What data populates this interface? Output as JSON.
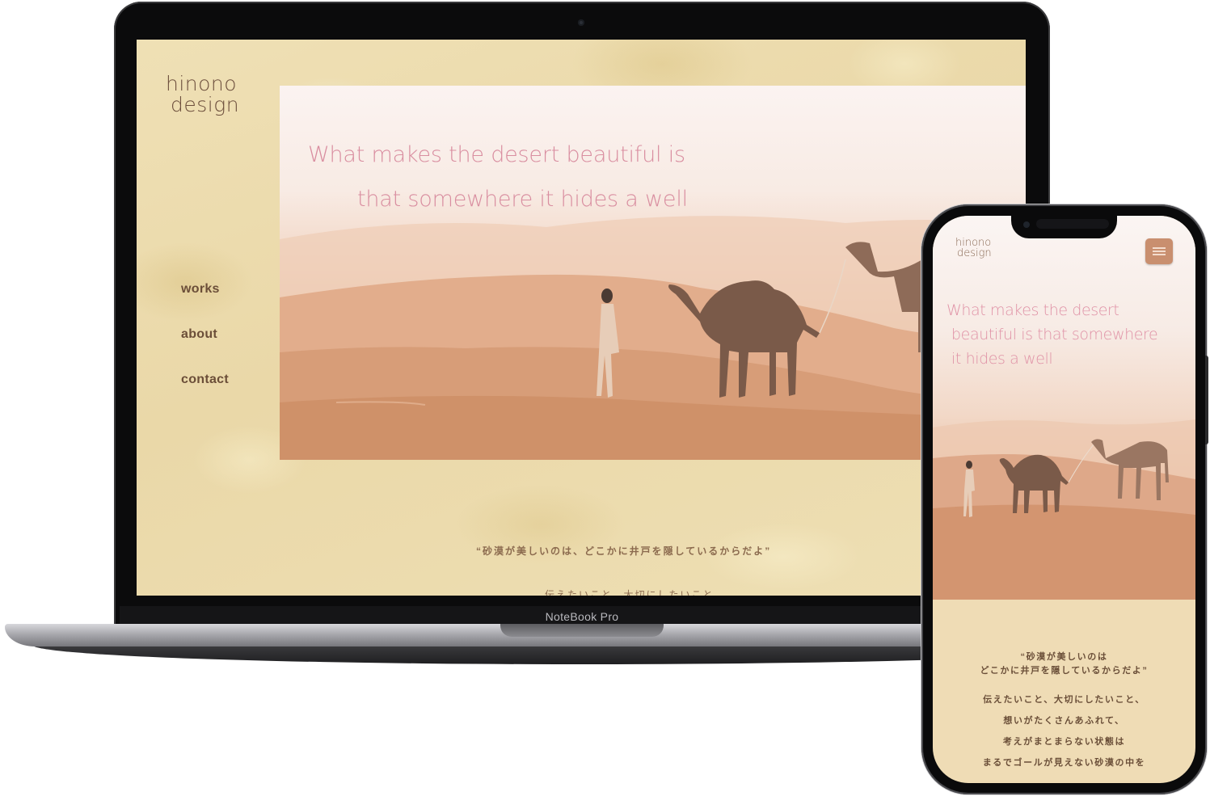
{
  "laptop": {
    "brand_label": "NoteBook Pro",
    "site": {
      "logo_line1": "hinono",
      "logo_line2": "design",
      "nav": [
        "works",
        "about",
        "contact"
      ],
      "hero_line1": "What makes the desert beautiful is",
      "hero_line2": "that somewhere it hides a well",
      "quote_jp": "“砂漠が美しいのは、どこかに井戸を隠しているからだよ”",
      "intro_jp": "伝えたいこと、大切にしたいこと"
    }
  },
  "phone": {
    "logo_line1": "hinono",
    "logo_line2": "design",
    "hero_lines": [
      "What makes the desert",
      "beautiful is that somewhere",
      "it hides a well"
    ],
    "quote_lines": [
      "“砂漠が美しいのは",
      "どこかに井戸を隠しているからだよ”"
    ],
    "paragraph_lines": [
      "伝えたいこと、大切にしたいこと、",
      "想いがたくさんあふれて、",
      "考えがまとまらない状態は",
      "まるでゴールが見えない砂漠の中を"
    ]
  },
  "colors": {
    "accent_pink": "#d98ea0",
    "brown_text": "#6b4e38",
    "sand_bg": "#efdcb5",
    "menu_button": "#c98f6f"
  },
  "icons": [
    "hamburger-menu-icon",
    "camera-icon"
  ]
}
